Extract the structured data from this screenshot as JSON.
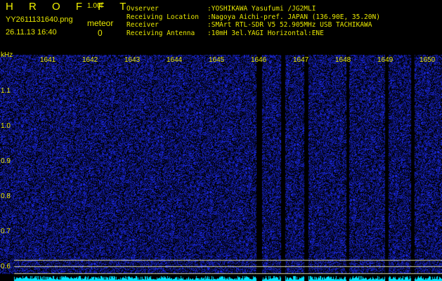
{
  "header": {
    "title": "H R O F F T",
    "version": "1.00f",
    "filename": "YY2611131640.png",
    "meteor_label": "meteor",
    "datetime": "26.11.13 16:40",
    "meteor_count": "0"
  },
  "info": {
    "labels": [
      "Ovserver",
      "Receiving Location",
      "Receiver",
      "Receiving Antenna"
    ],
    "values": [
      ":YOSHIKAWA Yasufumi /JG2MLI",
      ":Nagoya Aichi-pref. JAPAN (136.90E, 35.20N)",
      ":SMArt RTL-SDR V5 52.905MHz USB TACHIKAWA",
      ":10mH 3el.YAGI Horizontal:ENE"
    ]
  },
  "axis": {
    "y_unit": "kHz",
    "y_ticks": [
      "1.1",
      "1.0",
      "0.9",
      "0.8",
      "0.7",
      "0.6"
    ],
    "x_ticks": [
      "1641",
      "1642",
      "1643",
      "1644",
      "1645",
      "1646",
      "1647",
      "1648",
      "1649",
      "1650"
    ]
  },
  "colors": {
    "text": "#e8e800",
    "noise": "#1a2cff",
    "trace": "#00e5ff",
    "background": "#000000"
  }
}
